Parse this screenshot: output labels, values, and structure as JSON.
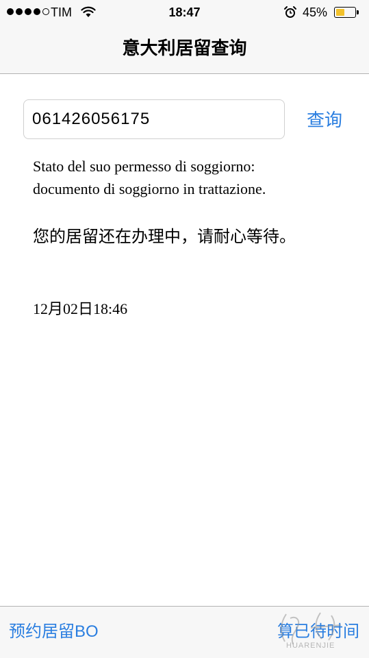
{
  "status_bar": {
    "carrier": "TIM",
    "time": "18:47",
    "battery_percent": "45%",
    "battery_level": 0.45,
    "signal_bars_filled": 4,
    "signal_bars_total": 5,
    "battery_fill_color": "#f2c12b"
  },
  "nav": {
    "title": "意大利居留查询"
  },
  "search": {
    "value": "061426056175",
    "button_label": "查询"
  },
  "result": {
    "line1": "Stato del suo permesso di soggiorno:",
    "line2": "documento di soggiorno in trattazione.",
    "chinese_message": "您的居留还在办理中，请耐心等待。",
    "timestamp": "12月02日18:46"
  },
  "toolbar": {
    "left_label": "预约居留BO",
    "right_label": "算已待时间"
  },
  "watermark": {
    "text": "HUARENJIE"
  },
  "colors": {
    "accent": "#2a7ee0",
    "bar_background": "#f7f7f7",
    "divider": "#b2b2b2"
  }
}
